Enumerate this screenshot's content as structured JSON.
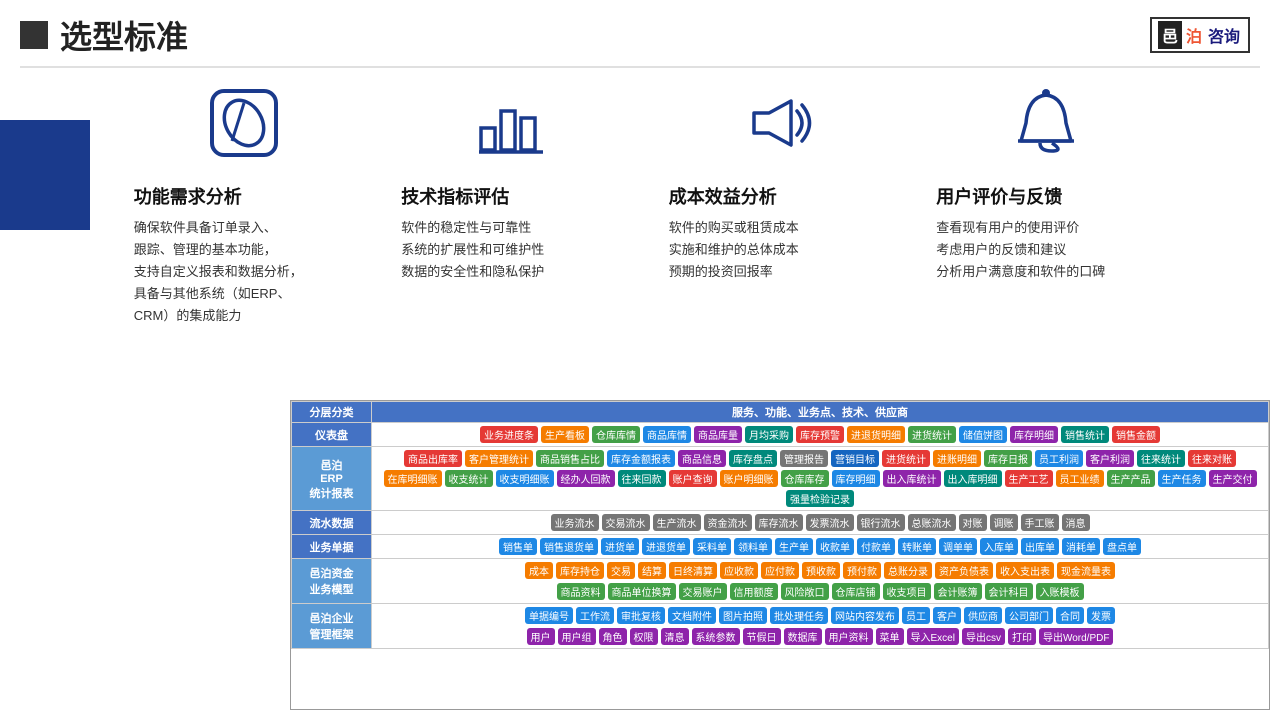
{
  "header": {
    "icon_label": "■",
    "title": "选型标准",
    "logo": {
      "yi": "邑",
      "bo": "泊",
      "rest": "咨询"
    }
  },
  "icons": [
    {
      "id": "feature",
      "type": "leaf",
      "title": "功能需求分析",
      "desc": "确保软件具备订单录入、\n跟踪、管理的基本功能，\n支持自定义报表和数据分析，\n具备与其他系统（如ERP、\nCRM）的集成能力"
    },
    {
      "id": "tech",
      "type": "chart",
      "title": "技术指标评估",
      "desc": "软件的稳定性与可靠性\n系统的扩展性和可维护性\n数据的安全性和隐私保护"
    },
    {
      "id": "cost",
      "type": "speaker",
      "title": "成本效益分析",
      "desc": "软件的购买或租赁成本\n实施和维护的总体成本\n预期的投资回报率"
    },
    {
      "id": "user",
      "type": "bell",
      "title": "用户评价与反馈",
      "desc": "查看现有用户的使用评价\n考虑用户的反馈和建议\n分析用户满意度和软件的口碑"
    }
  ],
  "table": {
    "header_col1": "分层分类",
    "header_col2": "服务、功能、业务点、技术、供应商",
    "rows": [
      {
        "label": "仪表盘",
        "label_style": "row-yibiaopan",
        "cells": [
          {
            "tags": [
              {
                "text": "业务进度条",
                "color": "red"
              },
              {
                "text": "生产看板",
                "color": "orange"
              },
              {
                "text": "仓库库情",
                "color": "green"
              },
              {
                "text": "商品库情",
                "color": "blue"
              },
              {
                "text": "商品库量",
                "color": "purple"
              },
              {
                "text": "月均采购",
                "color": "teal"
              },
              {
                "text": "库存预警",
                "color": "red"
              },
              {
                "text": "进退货明细",
                "color": "orange"
              },
              {
                "text": "进货统计",
                "color": "green"
              },
              {
                "text": "储值饼图",
                "color": "blue"
              },
              {
                "text": "库存明细",
                "color": "purple"
              },
              {
                "text": "销售统计",
                "color": "teal"
              },
              {
                "text": "销售金额",
                "color": "red"
              }
            ]
          }
        ]
      },
      {
        "label": "邑泊\nERP\n统计报表",
        "label_style": "row-yibiao",
        "cells": [
          {
            "tags": [
              {
                "text": "商品出库率",
                "color": "red"
              },
              {
                "text": "客户管理统计",
                "color": "orange"
              },
              {
                "text": "商品销售占比",
                "color": "green"
              },
              {
                "text": "库存金额报表",
                "color": "blue"
              },
              {
                "text": "商品信息",
                "color": "purple"
              },
              {
                "text": "库存盘点",
                "color": "teal"
              },
              {
                "text": "管理报告",
                "color": "gray"
              },
              {
                "text": "营销目标",
                "color": "dark-blue"
              },
              {
                "text": "进货统计",
                "color": "red"
              },
              {
                "text": "进账明细",
                "color": "orange"
              },
              {
                "text": "库存日报",
                "color": "green"
              },
              {
                "text": "员工利润",
                "color": "blue"
              },
              {
                "text": "客户利润",
                "color": "purple"
              },
              {
                "text": "往来统计",
                "color": "teal"
              },
              {
                "text": "往来对账",
                "color": "red"
              },
              {
                "text": "在库明细账",
                "color": "orange"
              },
              {
                "text": "收支统计",
                "color": "green"
              },
              {
                "text": "收支明细账",
                "color": "blue"
              },
              {
                "text": "经办人回款",
                "color": "purple"
              },
              {
                "text": "往来回款",
                "color": "teal"
              },
              {
                "text": "账户查询",
                "color": "red"
              },
              {
                "text": "账户明细账",
                "color": "orange"
              },
              {
                "text": "仓库库存",
                "color": "green"
              },
              {
                "text": "库存明细",
                "color": "blue"
              },
              {
                "text": "出入库统计",
                "color": "purple"
              },
              {
                "text": "出入库明细",
                "color": "teal"
              },
              {
                "text": "生产工艺",
                "color": "red"
              },
              {
                "text": "员工业绩",
                "color": "orange"
              },
              {
                "text": "生产产品",
                "color": "green"
              },
              {
                "text": "生产任务",
                "color": "blue"
              },
              {
                "text": "生产交付",
                "color": "purple"
              },
              {
                "text": "强量检验记录",
                "color": "teal"
              }
            ]
          }
        ]
      },
      {
        "label": "流水数据",
        "label_style": "row-liushuju",
        "cells": [
          {
            "tags": [
              {
                "text": "业务流水",
                "color": "gray"
              },
              {
                "text": "交易流水",
                "color": "gray"
              },
              {
                "text": "生产流水",
                "color": "gray"
              },
              {
                "text": "资金流水",
                "color": "gray"
              },
              {
                "text": "库存流水",
                "color": "gray"
              },
              {
                "text": "发票流水",
                "color": "gray"
              },
              {
                "text": "银行流水",
                "color": "gray"
              },
              {
                "text": "总账流水",
                "color": "gray"
              },
              {
                "text": "对账",
                "color": "gray"
              },
              {
                "text": "调账",
                "color": "gray"
              },
              {
                "text": "手工账",
                "color": "gray"
              },
              {
                "text": "消息",
                "color": "gray"
              }
            ]
          }
        ]
      },
      {
        "label": "业务单据",
        "label_style": "row-yewudanju",
        "cells": [
          {
            "tags": [
              {
                "text": "销售单",
                "color": "blue"
              },
              {
                "text": "销售退货单",
                "color": "blue"
              },
              {
                "text": "进货单",
                "color": "blue"
              },
              {
                "text": "进退货单",
                "color": "blue"
              },
              {
                "text": "采料单",
                "color": "blue"
              },
              {
                "text": "领料单",
                "color": "blue"
              },
              {
                "text": "生产单",
                "color": "blue"
              },
              {
                "text": "收款单",
                "color": "blue"
              },
              {
                "text": "付款单",
                "color": "blue"
              },
              {
                "text": "转账单",
                "color": "blue"
              },
              {
                "text": "调单单",
                "color": "blue"
              },
              {
                "text": "入库单",
                "color": "blue"
              },
              {
                "text": "出库单",
                "color": "blue"
              },
              {
                "text": "消耗单",
                "color": "blue"
              },
              {
                "text": "盘点单",
                "color": "blue"
              }
            ]
          }
        ]
      },
      {
        "label": "邑泊资金\n业务模型",
        "label_style": "row-zijin",
        "cells_row1": [
          {
            "text": "成本",
            "color": "orange"
          },
          {
            "text": "库存持仓",
            "color": "orange"
          },
          {
            "text": "交易",
            "color": "orange"
          },
          {
            "text": "结算",
            "color": "orange"
          },
          {
            "text": "日终清算",
            "color": "orange"
          },
          {
            "text": "应收款",
            "color": "orange"
          },
          {
            "text": "应付款",
            "color": "orange"
          },
          {
            "text": "预收款",
            "color": "orange"
          },
          {
            "text": "预付款",
            "color": "orange"
          },
          {
            "text": "总账分录",
            "color": "orange"
          },
          {
            "text": "资产负债表",
            "color": "orange"
          },
          {
            "text": "收入支出表",
            "color": "orange"
          },
          {
            "text": "现金流量表",
            "color": "orange"
          }
        ],
        "cells_row2": [
          {
            "text": "商品资料",
            "color": "green"
          },
          {
            "text": "商品单位换算",
            "color": "green"
          },
          {
            "text": "交易账户",
            "color": "green"
          },
          {
            "text": "信用额度",
            "color": "green"
          },
          {
            "text": "风险敞口",
            "color": "green"
          },
          {
            "text": "仓库店铺",
            "color": "green"
          },
          {
            "text": "收支项目",
            "color": "green"
          },
          {
            "text": "会计账簿",
            "color": "green"
          },
          {
            "text": "会计科目",
            "color": "green"
          },
          {
            "text": "入账模板",
            "color": "green"
          }
        ]
      },
      {
        "label": "邑泊企业\n管理框架",
        "label_style": "row-qiye",
        "cells_row1": [
          {
            "text": "单据编号",
            "color": "blue"
          },
          {
            "text": "工作流",
            "color": "blue"
          },
          {
            "text": "审批复核",
            "color": "blue"
          },
          {
            "text": "文档附件",
            "color": "blue"
          },
          {
            "text": "图片拍照",
            "color": "blue"
          },
          {
            "text": "批处理任务",
            "color": "blue"
          },
          {
            "text": "网站内容发布",
            "color": "blue"
          },
          {
            "text": "员工",
            "color": "blue"
          },
          {
            "text": "客户",
            "color": "blue"
          },
          {
            "text": "供应商",
            "color": "blue"
          },
          {
            "text": "公司部门",
            "color": "blue"
          },
          {
            "text": "合同",
            "color": "blue"
          },
          {
            "text": "发票",
            "color": "blue"
          }
        ],
        "cells_row2": [
          {
            "text": "用户",
            "color": "purple"
          },
          {
            "text": "用户组",
            "color": "purple"
          },
          {
            "text": "角色",
            "color": "purple"
          },
          {
            "text": "权限",
            "color": "purple"
          },
          {
            "text": "清息",
            "color": "purple"
          },
          {
            "text": "系统参数",
            "color": "purple"
          },
          {
            "text": "节假日",
            "color": "purple"
          },
          {
            "text": "数据库",
            "color": "purple"
          },
          {
            "text": "用户资料",
            "color": "purple"
          },
          {
            "text": "菜单",
            "color": "purple"
          },
          {
            "text": "导入Excel",
            "color": "purple"
          },
          {
            "text": "导出csv",
            "color": "purple"
          },
          {
            "text": "打印",
            "color": "purple"
          },
          {
            "text": "导出Word/PDF",
            "color": "purple"
          }
        ]
      }
    ]
  }
}
